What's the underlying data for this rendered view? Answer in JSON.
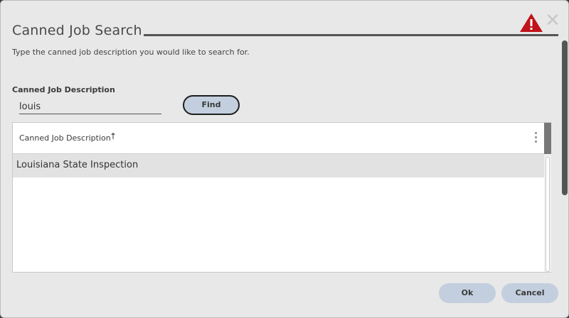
{
  "dialog": {
    "title": "Canned Job Search",
    "subtitle": "Type the canned job description you would like to search for."
  },
  "icons": {
    "warning": "warning-icon",
    "close": "close-icon",
    "sort": "sort-ascending-icon",
    "column_menu": "kebab-menu-icon"
  },
  "colors": {
    "button_bg": "#c3cfde",
    "warning_red": "#c0131a",
    "accent_edge": "#a020a0"
  },
  "search": {
    "label": "Canned Job Description",
    "value": "louis",
    "find_label": "Find"
  },
  "grid": {
    "columns": [
      "Canned Job Description"
    ],
    "rows": [
      [
        "Louisiana State Inspection"
      ]
    ]
  },
  "footer": {
    "ok_label": "Ok",
    "cancel_label": "Cancel"
  }
}
